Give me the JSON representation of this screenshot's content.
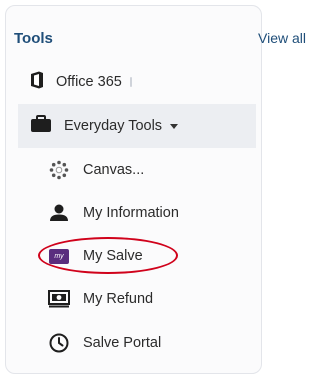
{
  "tools": {
    "title": "Tools",
    "view_all": "View all",
    "items": [
      {
        "label": "Office 365",
        "icon": "office-icon"
      },
      {
        "label": "Everyday Tools",
        "icon": "briefcase-icon",
        "expanded": true
      }
    ],
    "subitems": [
      {
        "label": "Canvas...",
        "icon": "canvas-icon"
      },
      {
        "label": "My Information",
        "icon": "person-icon"
      },
      {
        "label": "My Salve",
        "icon": "my-badge-icon",
        "badge_text": "my",
        "badge_color": "#5a2d7e",
        "annotated": true
      },
      {
        "label": "My Refund",
        "icon": "money-icon"
      },
      {
        "label": "Salve Portal",
        "icon": "clock-icon"
      }
    ]
  },
  "colors": {
    "title": "#1f4e79",
    "highlight_row": "#eceef2",
    "annotation": "#d0021b"
  }
}
